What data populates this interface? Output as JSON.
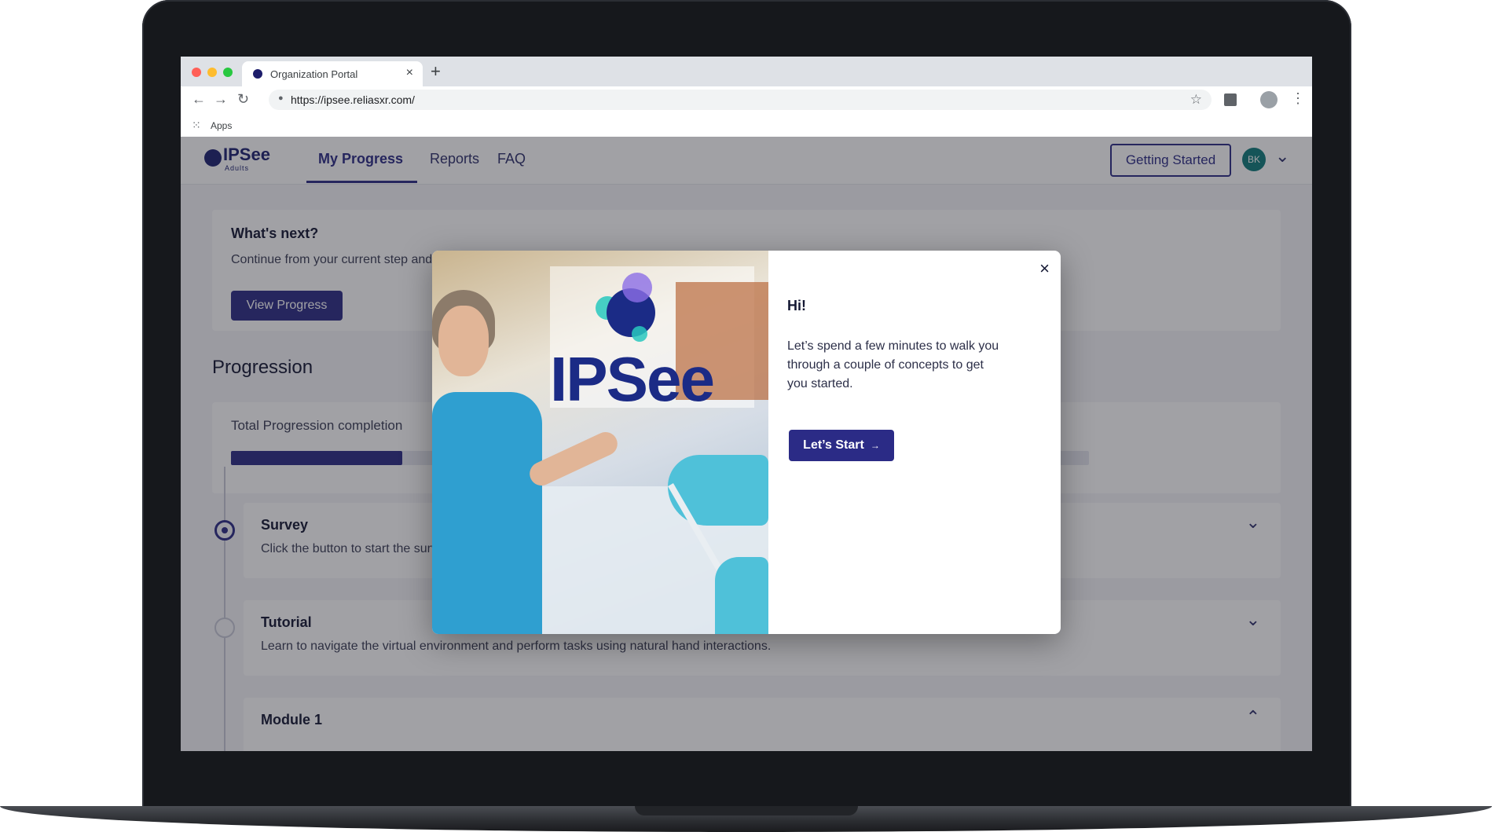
{
  "browser": {
    "tab_title": "Organization Portal",
    "tab_close": "×",
    "new_tab": "+",
    "url": "https://ipsee.reliasxr.com/",
    "bookmark_apps": "Apps",
    "back": "←",
    "forward": "→",
    "reload": "↻",
    "star": "☆",
    "menu": "⋮",
    "traffic_colors": [
      "#ff5f57",
      "#febc2e",
      "#28c840"
    ]
  },
  "app": {
    "logo": {
      "name": "IPSee",
      "sub": "Adults"
    },
    "nav": [
      "My Progress",
      "Reports",
      "FAQ"
    ],
    "getting_started": "Getting Started",
    "avatar_initials": "BK",
    "avatar_chevron": "⌄"
  },
  "whats_next": {
    "title": "What's next?",
    "text": "Continue from your current step and",
    "button": "View Progress"
  },
  "progression": {
    "title": "Progression",
    "label": "Total Progression completion",
    "percent": 20
  },
  "steps": [
    {
      "title": "Survey",
      "desc": "Click the button to start the survey. Survey completion is required to proceed to the next step.",
      "chevron": "⌄",
      "state": "active"
    },
    {
      "title": "Tutorial",
      "desc": "Learn to navigate the virtual environment and perform tasks using natural hand interactions.",
      "chevron": "⌄",
      "state": "idle"
    },
    {
      "title": "Module 1",
      "desc": "",
      "chevron": "⌃",
      "state": "idle"
    }
  ],
  "modal": {
    "hero_logo": "IPSee",
    "close": "×",
    "title": "Hi!",
    "body": "Let’s spend a few minutes to walk you through a couple of concepts to get you started.",
    "button": "Let’s Start",
    "button_arrow": "→"
  },
  "colors": {
    "brand": "#2b2b86",
    "avatar": "#0f7b7a"
  }
}
